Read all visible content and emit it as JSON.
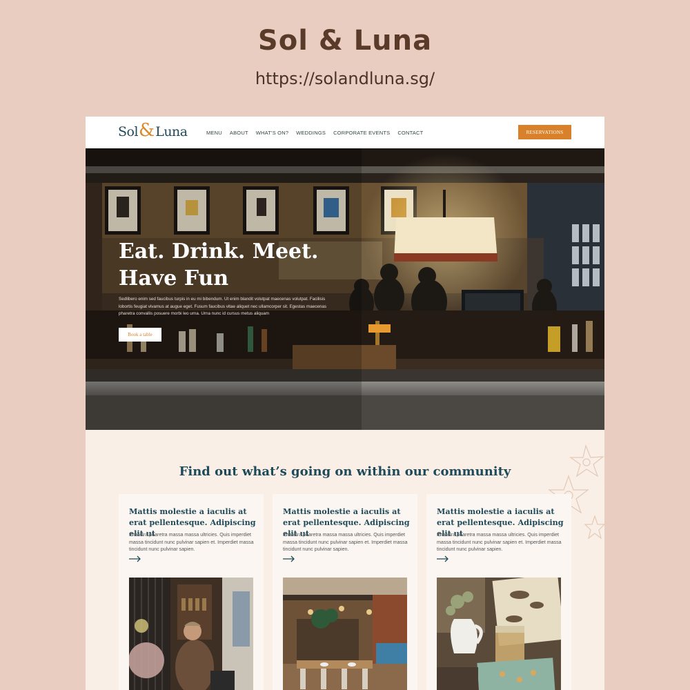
{
  "presentation": {
    "title": "Sol & Luna",
    "url": "https://solandluna.sg/"
  },
  "nav": {
    "logo": {
      "word1": "Sol",
      "amp": "&",
      "word2": "Luna"
    },
    "menu": [
      "MENU",
      "ABOUT",
      "WHAT'S ON?",
      "WEDDINGS",
      "CORPORATE EVENTS",
      "CONTACT"
    ],
    "reservations_label": "RESERVATIONS"
  },
  "hero": {
    "heading_line1": "Eat. Drink. Meet.",
    "heading_line2": "Have Fun",
    "body": "Sedlibero enim sed faucibus turpis in eu mi bibendum. Ut enim blandit volutpat maecenas volutpat. Facilisis lobortis feugiat vivamus at augue eget. Fusum faucibus vitae aliquet nec ullamcorper sit. Egestas maecenas pharetra convallis posuere morbi leo urna. Urna nunc id cursus metus aliquam",
    "button_label": "Book a table"
  },
  "community": {
    "title": "Find out what’s going on within our community",
    "cards": [
      {
        "title": "Mattis molestie a iaculis at erat pellentesque. Adipiscing elit ut",
        "body": "Pharetra pharetra massa massa ultricies. Quis imperdiet massa tincidunt nunc pulvinar sapien et. Imperdiet massa tincidunt nunc pulvinar sapien."
      },
      {
        "title": "Mattis molestie a iaculis at erat pellentesque. Adipiscing elit ut",
        "body": "Pharetra pharetra massa massa ultricies. Quis imperdiet massa tincidunt nunc pulvinar sapien et. Imperdiet massa tincidunt nunc pulvinar sapien."
      },
      {
        "title": "Mattis molestie a iaculis at erat pellentesque. Adipiscing elit ut",
        "body": "Pharetra pharetra massa massa ultricies. Quis imperdiet massa tincidunt nunc pulvinar sapien et. Imperdiet massa tincidunt nunc pulvinar sapien."
      }
    ]
  },
  "colors": {
    "background": "#e9cdc0",
    "brand_teal": "#1f4a59",
    "accent_orange": "#d9812a",
    "section_bg": "#f9efe6"
  },
  "icons": {
    "card_arrow": "arrow-right-icon",
    "decoration": "flower-icon"
  }
}
